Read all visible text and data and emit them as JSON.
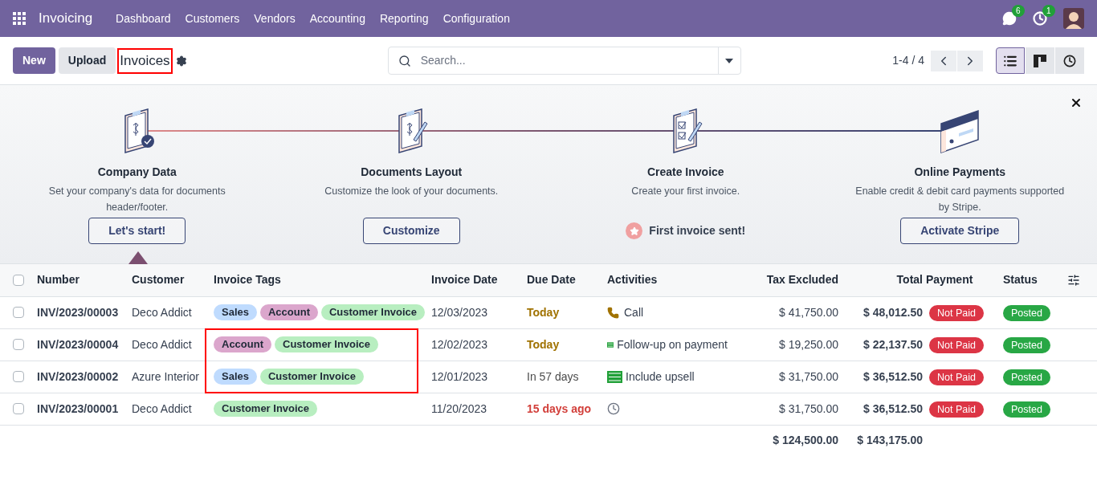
{
  "navbar": {
    "app_name": "Invoicing",
    "menu": [
      "Dashboard",
      "Customers",
      "Vendors",
      "Accounting",
      "Reporting",
      "Configuration"
    ],
    "messages_count": "6",
    "activities_count": "1"
  },
  "control_panel": {
    "buttons": [
      "New",
      "Upload"
    ],
    "title": "Invoices",
    "search": {
      "placeholder": "Search..."
    },
    "pager": "1-4 / 4",
    "views": [
      {
        "kind": "list",
        "selected": true
      },
      {
        "kind": "kanban",
        "selected": false
      },
      {
        "kind": "activity",
        "selected": false
      }
    ]
  },
  "onboarding": {
    "steps": [
      {
        "kind": "company",
        "title": "Company Data",
        "description": "Set your company's data for documents header/footer.",
        "action": {
          "kind": "button",
          "label": "Let's start!"
        }
      },
      {
        "kind": "layout",
        "title": "Documents Layout",
        "description": "Customize the look of your documents.",
        "action": {
          "kind": "button",
          "label": "Customize"
        }
      },
      {
        "kind": "invoice",
        "title": "Create Invoice",
        "description": "Create your first invoice.",
        "action": {
          "kind": "done",
          "label": "First invoice sent!"
        }
      },
      {
        "kind": "payment",
        "title": "Online Payments",
        "description": "Enable credit & debit card payments supported by Stripe.",
        "action": {
          "kind": "button",
          "label": "Activate Stripe"
        }
      }
    ]
  },
  "table": {
    "select_all": {
      "checked": false
    },
    "columns": [
      "Number",
      "Customer",
      "Invoice Tags",
      "Invoice Date",
      "Due Date",
      "Activities",
      "Tax Excluded",
      "Total",
      "Payment",
      "Status"
    ],
    "rows": [
      {
        "checked": false,
        "number": "INV/2023/00003",
        "customer": "Deco Addict",
        "tags": [
          {
            "label": "Sales",
            "color": "#bfdbfe"
          },
          {
            "label": "Account",
            "color": "#dba6cc"
          },
          {
            "label": "Customer Invoice",
            "color": "#b8eec0"
          }
        ],
        "invoice_date": "12/03/2023",
        "due_date": {
          "text": "Today",
          "kind": "today"
        },
        "activity": {
          "kind": "call",
          "text": "Call"
        },
        "tax_excluded": "$ 41,750.00",
        "total": "$ 48,012.50",
        "payment": "Not Paid",
        "status": "Posted"
      },
      {
        "checked": false,
        "number": "INV/2023/00004",
        "customer": "Deco Addict",
        "tags": [
          {
            "label": "Account",
            "color": "#dba6cc"
          },
          {
            "label": "Customer Invoice",
            "color": "#b8eec0"
          }
        ],
        "invoice_date": "12/02/2023",
        "due_date": {
          "text": "Today",
          "kind": "today"
        },
        "activity": {
          "kind": "todo",
          "text": "Follow-up on payment"
        },
        "tax_excluded": "$ 19,250.00",
        "total": "$ 22,137.50",
        "payment": "Not Paid",
        "status": "Posted"
      },
      {
        "checked": false,
        "number": "INV/2023/00002",
        "customer": "Azure Interior",
        "tags": [
          {
            "label": "Sales",
            "color": "#bfdbfe"
          },
          {
            "label": "Customer Invoice",
            "color": "#b8eec0"
          }
        ],
        "invoice_date": "12/01/2023",
        "due_date": {
          "text": "In 57 days",
          "kind": "future"
        },
        "activity": {
          "kind": "todo",
          "text": "Include upsell"
        },
        "tax_excluded": "$ 31,750.00",
        "total": "$ 36,512.50",
        "payment": "Not Paid",
        "status": "Posted"
      },
      {
        "checked": false,
        "number": "INV/2023/00001",
        "customer": "Deco Addict",
        "tags": [
          {
            "label": "Customer Invoice",
            "color": "#b8eec0"
          }
        ],
        "invoice_date": "11/20/2023",
        "due_date": {
          "text": "15 days ago",
          "kind": "overdue"
        },
        "activity": {
          "kind": "none"
        },
        "tax_excluded": "$ 31,750.00",
        "total": "$ 36,512.50",
        "payment": "Not Paid",
        "status": "Posted"
      }
    ],
    "totals": {
      "tax_excluded": "$ 124,500.00",
      "total": "$ 143,175.00"
    }
  }
}
